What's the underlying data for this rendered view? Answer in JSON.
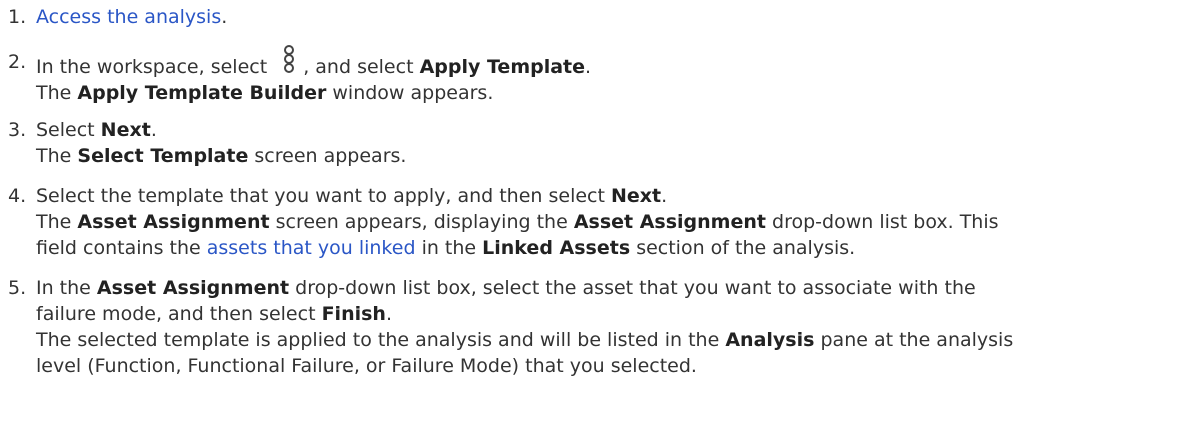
{
  "steps": [
    {
      "num": "1.",
      "link": "Access the analysis",
      "tail": "."
    },
    {
      "num": "2.",
      "pre": "In the workspace, select",
      "icon": "kebab-menu-icon",
      "mid": ", and select",
      "bold1": "Apply Template",
      "end": ".",
      "r_bold": "Apply Template Builder",
      "r_tail": "window appears."
    },
    {
      "num": "3.",
      "pre": "Select",
      "bold1": "Next",
      "end": ".",
      "r_pre": "The",
      "r_bold": "Select Template",
      "r_tail": "screen appears."
    },
    {
      "num": "4.",
      "pre": "Select the template that you want to apply, and then select",
      "bold1": "Next",
      "end": ".",
      "r_pre": "The",
      "r_bold": "Asset Assignment",
      "r_mid": "screen appears, displaying the",
      "r_bold2": "Asset Assignment",
      "r_tail": "drop-down list box. This",
      "l3_pre": "field contains the",
      "l3_link": "assets that you linked",
      "l3_mid": "in the",
      "l3_bold": "Linked Assets",
      "l3_tail": "section of the analysis."
    },
    {
      "num": "5.",
      "pre": "In the",
      "bold1": "Asset Assignment",
      "mid": "drop-down list box, select the asset that you want to associate with the",
      "l2": "failure mode, and then select",
      "l2_bold": "Finish",
      "l2_end": ".",
      "r_pre": "The selected template is applied to the analysis and will be listed in the",
      "r_bold": "Analysis",
      "r_tail": "pane at the analysis",
      "l5": "level (Function, Functional Failure, or Failure Mode) that you selected."
    }
  ]
}
